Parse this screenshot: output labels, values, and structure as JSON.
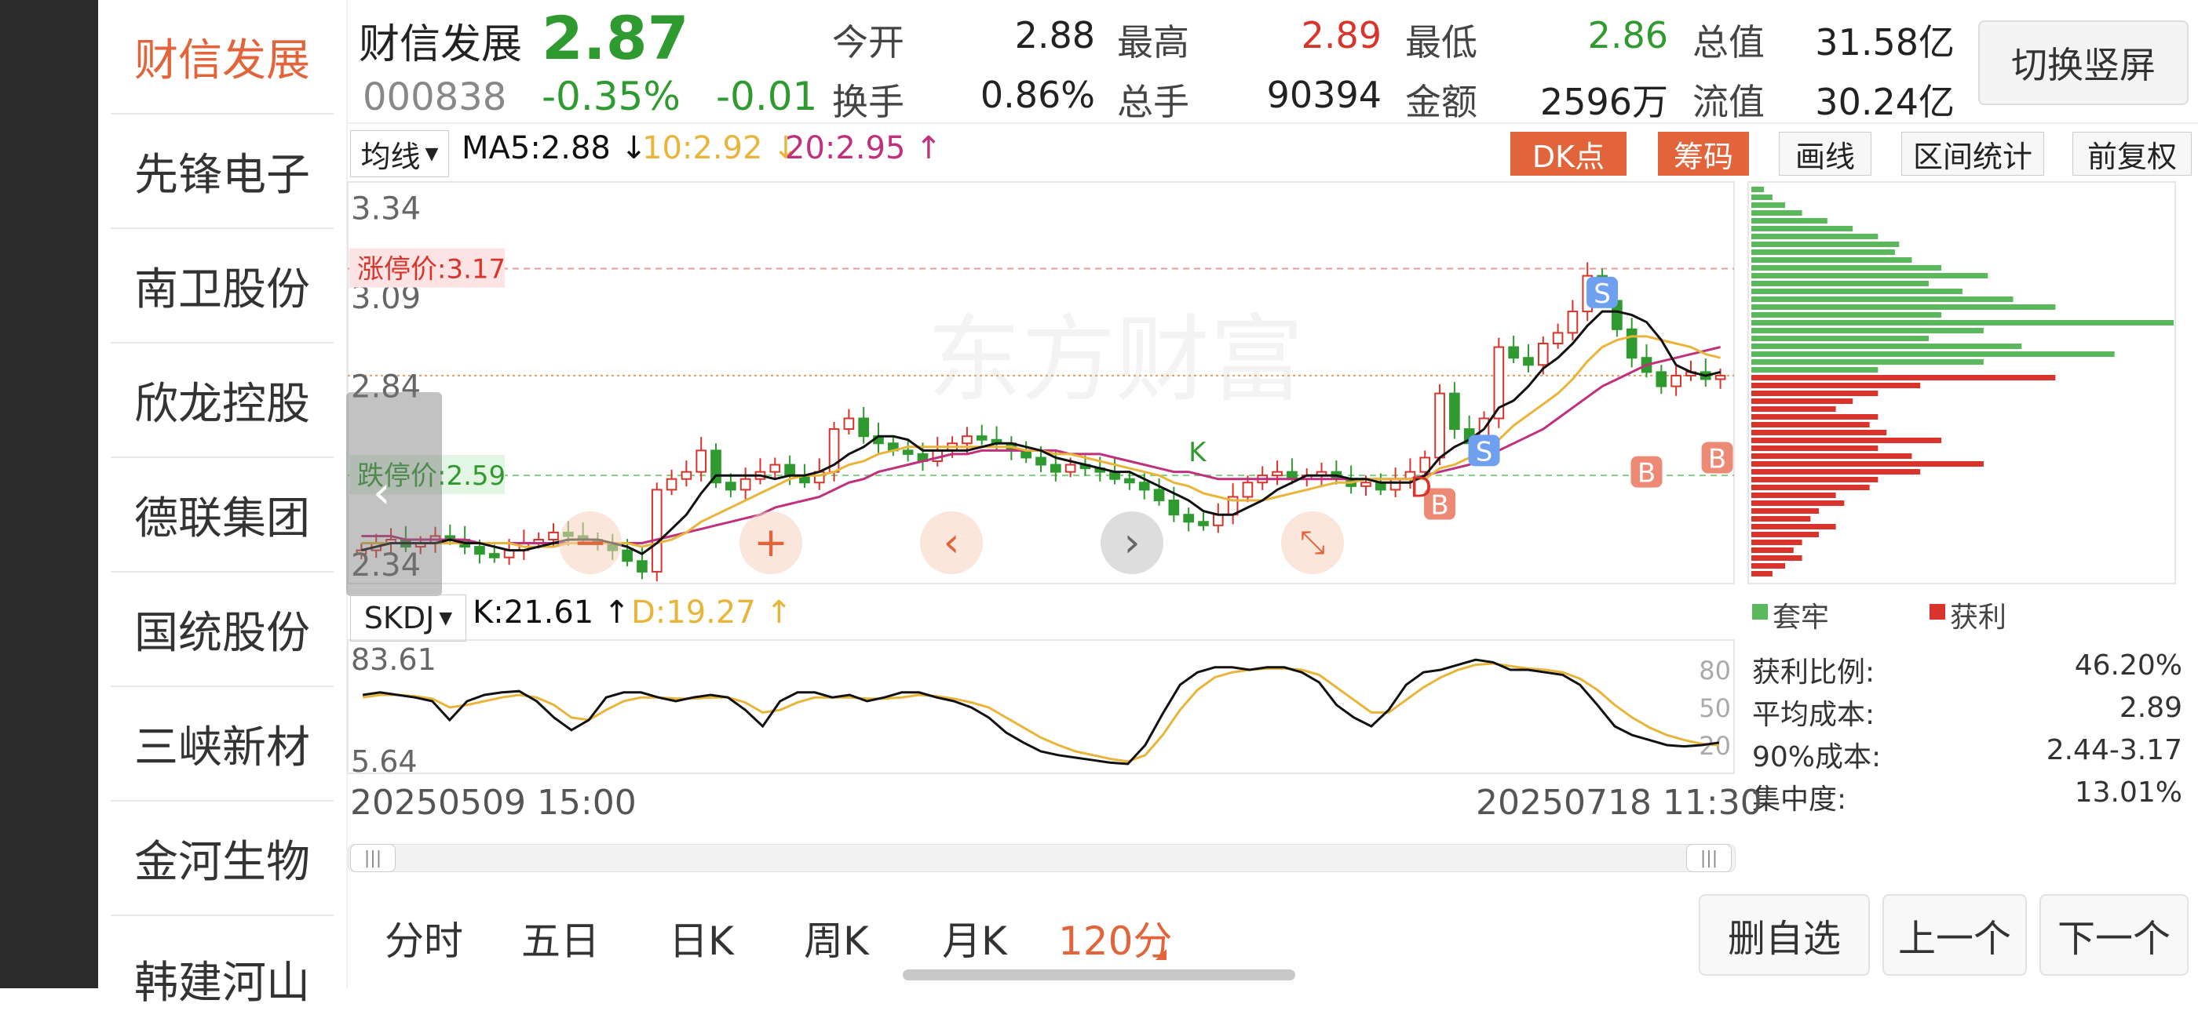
{
  "sidebar": {
    "items": [
      "财信发展",
      "先锋电子",
      "南卫股份",
      "欣龙控股",
      "德联集团",
      "国统股份",
      "三峡新材",
      "金河生物",
      "韩建河山"
    ]
  },
  "header": {
    "name": "财信发展",
    "price": "2.87",
    "code": "000838",
    "pct": "-0.35%",
    "chg": "-0.01",
    "switch_label": "切换竖屏",
    "quotes": [
      {
        "label": "今开",
        "value": "2.88",
        "color": "#222222"
      },
      {
        "label": "最高",
        "value": "2.89",
        "color": "#d9342b"
      },
      {
        "label": "最低",
        "value": "2.86",
        "color": "#2f9a2f"
      },
      {
        "label": "总值",
        "value": "31.58亿",
        "color": "#222222"
      },
      {
        "label": "换手",
        "value": "0.86%",
        "color": "#222222"
      },
      {
        "label": "总手",
        "value": "90394",
        "color": "#222222"
      },
      {
        "label": "金额",
        "value": "2596万",
        "color": "#222222"
      },
      {
        "label": "流值",
        "value": "30.24亿",
        "color": "#222222"
      }
    ]
  },
  "indicator_bar": {
    "selector": "均线",
    "ma5": "MA5:2.88",
    "ma10": "10:2.92",
    "ma20": "20:2.95",
    "dk_label": "DK点",
    "chip_label": "筹码",
    "draw_label": "画线",
    "range_label": "区间统计",
    "adjust_label": "前复权"
  },
  "sub_indicator": {
    "selector": "SKDJ",
    "k": "K:21.61",
    "d": "D:19.27"
  },
  "chart_data": {
    "type": "candlestick",
    "price_ticks": [
      "3.34",
      "3.09",
      "2.84",
      "2.59",
      "2.34"
    ],
    "limit_up": "涨停价:3.17",
    "limit_down": "跌停价:2.59",
    "kd_ticks": [
      "83.61",
      "5.64"
    ],
    "kd_levels": [
      "80",
      "50",
      "20"
    ],
    "start_time": "20250509 15:00",
    "end_time": "20250718 11:30",
    "closes": [
      2.38,
      2.4,
      2.41,
      2.39,
      2.4,
      2.42,
      2.41,
      2.39,
      2.37,
      2.36,
      2.38,
      2.4,
      2.41,
      2.43,
      2.42,
      2.41,
      2.4,
      2.38,
      2.35,
      2.32,
      2.55,
      2.58,
      2.6,
      2.66,
      2.57,
      2.55,
      2.58,
      2.6,
      2.62,
      2.59,
      2.57,
      2.6,
      2.72,
      2.75,
      2.7,
      2.68,
      2.66,
      2.65,
      2.63,
      2.66,
      2.68,
      2.7,
      2.69,
      2.68,
      2.66,
      2.64,
      2.62,
      2.6,
      2.62,
      2.61,
      2.6,
      2.58,
      2.57,
      2.55,
      2.52,
      2.48,
      2.46,
      2.45,
      2.48,
      2.53,
      2.57,
      2.59,
      2.6,
      2.58,
      2.59,
      2.6,
      2.58,
      2.56,
      2.57,
      2.55,
      2.58,
      2.6,
      2.64,
      2.82,
      2.72,
      2.68,
      2.75,
      2.95,
      2.92,
      2.9,
      2.96,
      2.99,
      3.05,
      3.15,
      3.08,
      3.0,
      2.92,
      2.88,
      2.84,
      2.87,
      2.88,
      2.86,
      2.87
    ],
    "ma5": [
      2.38,
      2.39,
      2.4,
      2.4,
      2.4,
      2.4,
      2.41,
      2.4,
      2.4,
      2.39,
      2.38,
      2.38,
      2.39,
      2.4,
      2.41,
      2.41,
      2.41,
      2.4,
      2.39,
      2.37,
      2.4,
      2.44,
      2.48,
      2.54,
      2.59,
      2.59,
      2.59,
      2.59,
      2.58,
      2.59,
      2.59,
      2.6,
      2.62,
      2.65,
      2.67,
      2.7,
      2.7,
      2.69,
      2.66,
      2.66,
      2.66,
      2.66,
      2.67,
      2.68,
      2.68,
      2.67,
      2.66,
      2.64,
      2.63,
      2.62,
      2.61,
      2.6,
      2.6,
      2.58,
      2.56,
      2.54,
      2.52,
      2.49,
      2.48,
      2.48,
      2.5,
      2.52,
      2.55,
      2.57,
      2.59,
      2.59,
      2.59,
      2.58,
      2.58,
      2.57,
      2.57,
      2.57,
      2.59,
      2.64,
      2.67,
      2.69,
      2.72,
      2.78,
      2.8,
      2.84,
      2.89,
      2.92,
      2.96,
      3.01,
      3.05,
      3.05,
      3.04,
      3.02,
      2.97,
      2.9,
      2.88,
      2.87,
      2.88
    ],
    "ma10": [
      2.4,
      2.4,
      2.4,
      2.4,
      2.4,
      2.4,
      2.4,
      2.4,
      2.4,
      2.4,
      2.4,
      2.39,
      2.39,
      2.39,
      2.4,
      2.4,
      2.4,
      2.4,
      2.4,
      2.39,
      2.4,
      2.41,
      2.43,
      2.46,
      2.48,
      2.5,
      2.52,
      2.54,
      2.56,
      2.58,
      2.59,
      2.59,
      2.6,
      2.62,
      2.63,
      2.65,
      2.66,
      2.67,
      2.67,
      2.67,
      2.67,
      2.67,
      2.67,
      2.67,
      2.67,
      2.66,
      2.66,
      2.65,
      2.65,
      2.64,
      2.63,
      2.62,
      2.61,
      2.6,
      2.59,
      2.57,
      2.56,
      2.54,
      2.53,
      2.52,
      2.52,
      2.52,
      2.53,
      2.54,
      2.55,
      2.56,
      2.57,
      2.57,
      2.58,
      2.58,
      2.58,
      2.58,
      2.58,
      2.61,
      2.62,
      2.64,
      2.65,
      2.69,
      2.73,
      2.76,
      2.79,
      2.82,
      2.86,
      2.91,
      2.95,
      2.97,
      2.98,
      2.98,
      2.97,
      2.96,
      2.95,
      2.93,
      2.92
    ],
    "ma20": [
      2.42,
      2.42,
      2.42,
      2.41,
      2.41,
      2.41,
      2.41,
      2.41,
      2.4,
      2.4,
      2.4,
      2.4,
      2.4,
      2.4,
      2.4,
      2.4,
      2.4,
      2.4,
      2.4,
      2.4,
      2.41,
      2.42,
      2.43,
      2.44,
      2.45,
      2.46,
      2.47,
      2.48,
      2.5,
      2.51,
      2.52,
      2.53,
      2.55,
      2.57,
      2.58,
      2.6,
      2.61,
      2.62,
      2.63,
      2.64,
      2.65,
      2.65,
      2.66,
      2.66,
      2.66,
      2.66,
      2.66,
      2.66,
      2.65,
      2.65,
      2.65,
      2.64,
      2.63,
      2.62,
      2.61,
      2.6,
      2.6,
      2.59,
      2.58,
      2.58,
      2.58,
      2.58,
      2.58,
      2.58,
      2.58,
      2.58,
      2.58,
      2.58,
      2.58,
      2.58,
      2.58,
      2.58,
      2.59,
      2.6,
      2.61,
      2.62,
      2.64,
      2.66,
      2.68,
      2.7,
      2.72,
      2.75,
      2.78,
      2.81,
      2.84,
      2.86,
      2.88,
      2.9,
      2.91,
      2.92,
      2.93,
      2.94,
      2.95
    ],
    "k": [
      60,
      62,
      60,
      58,
      55,
      40,
      55,
      60,
      62,
      63,
      55,
      42,
      32,
      40,
      58,
      62,
      62,
      58,
      55,
      58,
      60,
      58,
      48,
      35,
      55,
      62,
      62,
      58,
      60,
      55,
      58,
      62,
      62,
      58,
      55,
      50,
      42,
      30,
      22,
      15,
      12,
      10,
      8,
      6,
      5,
      20,
      45,
      68,
      78,
      82,
      82,
      80,
      82,
      82,
      78,
      70,
      52,
      42,
      35,
      48,
      68,
      78,
      80,
      84,
      88,
      86,
      80,
      80,
      78,
      76,
      68,
      52,
      35,
      28,
      24,
      20,
      19,
      20,
      22
    ],
    "d": [
      58,
      60,
      60,
      59,
      57,
      50,
      52,
      55,
      58,
      60,
      58,
      52,
      42,
      40,
      48,
      55,
      58,
      58,
      57,
      57,
      58,
      58,
      54,
      46,
      48,
      54,
      58,
      58,
      58,
      57,
      57,
      58,
      60,
      59,
      57,
      54,
      50,
      42,
      34,
      26,
      20,
      15,
      12,
      9,
      7,
      12,
      28,
      48,
      64,
      74,
      78,
      80,
      81,
      81,
      80,
      76,
      66,
      56,
      46,
      46,
      56,
      66,
      74,
      80,
      84,
      85,
      83,
      81,
      80,
      78,
      73,
      64,
      52,
      42,
      34,
      28,
      24,
      21,
      20
    ],
    "chip_profile": [
      {
        "pos": 0.0,
        "len": 0.03,
        "type": "trap"
      },
      {
        "pos": 0.02,
        "len": 0.05,
        "type": "trap"
      },
      {
        "pos": 0.04,
        "len": 0.08,
        "type": "trap"
      },
      {
        "pos": 0.06,
        "len": 0.12,
        "type": "trap"
      },
      {
        "pos": 0.08,
        "len": 0.18,
        "type": "trap"
      },
      {
        "pos": 0.1,
        "len": 0.24,
        "type": "trap"
      },
      {
        "pos": 0.12,
        "len": 0.3,
        "type": "trap"
      },
      {
        "pos": 0.14,
        "len": 0.35,
        "type": "trap"
      },
      {
        "pos": 0.16,
        "len": 0.34,
        "type": "trap"
      },
      {
        "pos": 0.18,
        "len": 0.38,
        "type": "trap"
      },
      {
        "pos": 0.2,
        "len": 0.45,
        "type": "trap"
      },
      {
        "pos": 0.22,
        "len": 0.56,
        "type": "trap"
      },
      {
        "pos": 0.24,
        "len": 0.42,
        "type": "trap"
      },
      {
        "pos": 0.26,
        "len": 0.5,
        "type": "trap"
      },
      {
        "pos": 0.28,
        "len": 0.62,
        "type": "trap"
      },
      {
        "pos": 0.3,
        "len": 0.72,
        "type": "trap"
      },
      {
        "pos": 0.32,
        "len": 0.45,
        "type": "trap"
      },
      {
        "pos": 0.34,
        "len": 1.0,
        "type": "trap"
      },
      {
        "pos": 0.36,
        "len": 0.55,
        "type": "trap"
      },
      {
        "pos": 0.38,
        "len": 0.42,
        "type": "trap"
      },
      {
        "pos": 0.4,
        "len": 0.64,
        "type": "trap"
      },
      {
        "pos": 0.42,
        "len": 0.86,
        "type": "trap"
      },
      {
        "pos": 0.44,
        "len": 0.55,
        "type": "trap"
      },
      {
        "pos": 0.46,
        "len": 0.3,
        "type": "trap"
      },
      {
        "pos": 0.48,
        "len": 0.72,
        "type": "profit"
      },
      {
        "pos": 0.5,
        "len": 0.4,
        "type": "profit"
      },
      {
        "pos": 0.52,
        "len": 0.3,
        "type": "profit"
      },
      {
        "pos": 0.54,
        "len": 0.24,
        "type": "profit"
      },
      {
        "pos": 0.56,
        "len": 0.2,
        "type": "profit"
      },
      {
        "pos": 0.58,
        "len": 0.3,
        "type": "profit"
      },
      {
        "pos": 0.6,
        "len": 0.28,
        "type": "profit"
      },
      {
        "pos": 0.62,
        "len": 0.32,
        "type": "profit"
      },
      {
        "pos": 0.64,
        "len": 0.45,
        "type": "profit"
      },
      {
        "pos": 0.66,
        "len": 0.3,
        "type": "profit"
      },
      {
        "pos": 0.68,
        "len": 0.38,
        "type": "profit"
      },
      {
        "pos": 0.7,
        "len": 0.55,
        "type": "profit"
      },
      {
        "pos": 0.72,
        "len": 0.4,
        "type": "profit"
      },
      {
        "pos": 0.74,
        "len": 0.3,
        "type": "profit"
      },
      {
        "pos": 0.76,
        "len": 0.28,
        "type": "profit"
      },
      {
        "pos": 0.78,
        "len": 0.2,
        "type": "profit"
      },
      {
        "pos": 0.8,
        "len": 0.22,
        "type": "profit"
      },
      {
        "pos": 0.82,
        "len": 0.16,
        "type": "profit"
      },
      {
        "pos": 0.84,
        "len": 0.14,
        "type": "profit"
      },
      {
        "pos": 0.86,
        "len": 0.2,
        "type": "profit"
      },
      {
        "pos": 0.88,
        "len": 0.16,
        "type": "profit"
      },
      {
        "pos": 0.9,
        "len": 0.12,
        "type": "profit"
      },
      {
        "pos": 0.92,
        "len": 0.1,
        "type": "profit"
      },
      {
        "pos": 0.94,
        "len": 0.12,
        "type": "profit"
      },
      {
        "pos": 0.96,
        "len": 0.08,
        "type": "profit"
      },
      {
        "pos": 0.98,
        "len": 0.05,
        "type": "profit"
      }
    ]
  },
  "chip_legend": {
    "trap": "套牢",
    "profit": "获利"
  },
  "chip_stats": [
    {
      "label": "获利比例:",
      "value": "46.20%"
    },
    {
      "label": "平均成本:",
      "value": "2.89"
    },
    {
      "label": "90%成本:",
      "value": "2.44-3.17"
    },
    {
      "label": "集中度:",
      "value": "13.01%"
    }
  ],
  "bottom_tabs": [
    "分时",
    "五日",
    "日K",
    "周K",
    "月K",
    "120分"
  ],
  "bottom_buttons": {
    "delete": "删自选",
    "prev": "上一个",
    "next": "下一个"
  },
  "watermark": "东方财富",
  "colors": {
    "up": "#d9342b",
    "down": "#2f9a2f",
    "ma5": "#111111",
    "ma10": "#e8b53a",
    "ma20": "#c0307c",
    "accent": "#e2643a"
  }
}
